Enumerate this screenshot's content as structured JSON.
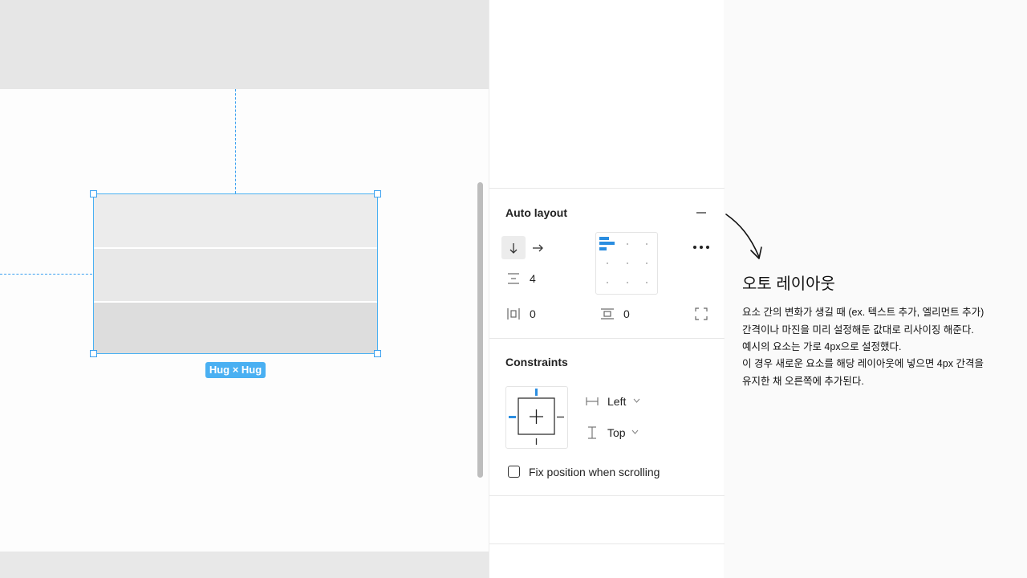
{
  "canvas": {
    "size_badge": "Hug × Hug"
  },
  "auto_layout": {
    "title": "Auto layout",
    "direction": "vertical",
    "spacing_value": "4",
    "horizontal_padding": "0",
    "vertical_padding": "0"
  },
  "constraints": {
    "title": "Constraints",
    "horizontal": "Left",
    "vertical": "Top",
    "fix_position_label": "Fix position when scrolling"
  },
  "note": {
    "title": "오토 레이아웃",
    "lines": [
      "요소 간의 변화가 생길 때 (ex. 텍스트 추가, 엘리먼트 추가)",
      "간격이나 마진을 미리 설정해둔 값대로 리사이징 해준다.",
      "예시의 요소는 가로 4px으로 설정했다.",
      "이 경우 새로운 요소를 해당 레이아웃에 넣으면 4px 간격을",
      "유지한 채 오른쪽에 추가된다."
    ]
  },
  "colors": {
    "selection": "#4ab0f2",
    "accent": "#2a8de0"
  }
}
